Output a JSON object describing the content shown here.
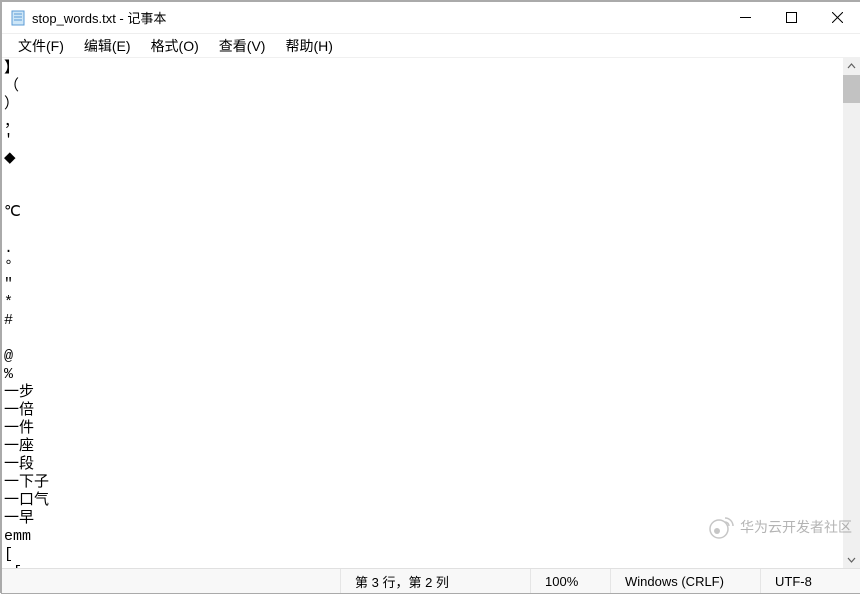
{
  "window": {
    "title": "stop_words.txt - 记事本"
  },
  "menu": {
    "file": "文件(F)",
    "edit": "编辑(E)",
    "format": "格式(O)",
    "view": "查看(V)",
    "help": "帮助(H)"
  },
  "content": "】\n（\n）\n，\n'\n◆\n\n\n℃\n\n.\n°\n\"\n*\n#\n\n@\n%\n一步\n一倍\n一件\n一座\n一段\n一下子\n一口气\n一早\nemm\n[\n [",
  "status": {
    "position": "第 3 行，第 2 列",
    "zoom": "100%",
    "lineending": "Windows (CRLF)",
    "encoding": "UTF-8"
  },
  "watermark_text": "华为云开发者社区"
}
